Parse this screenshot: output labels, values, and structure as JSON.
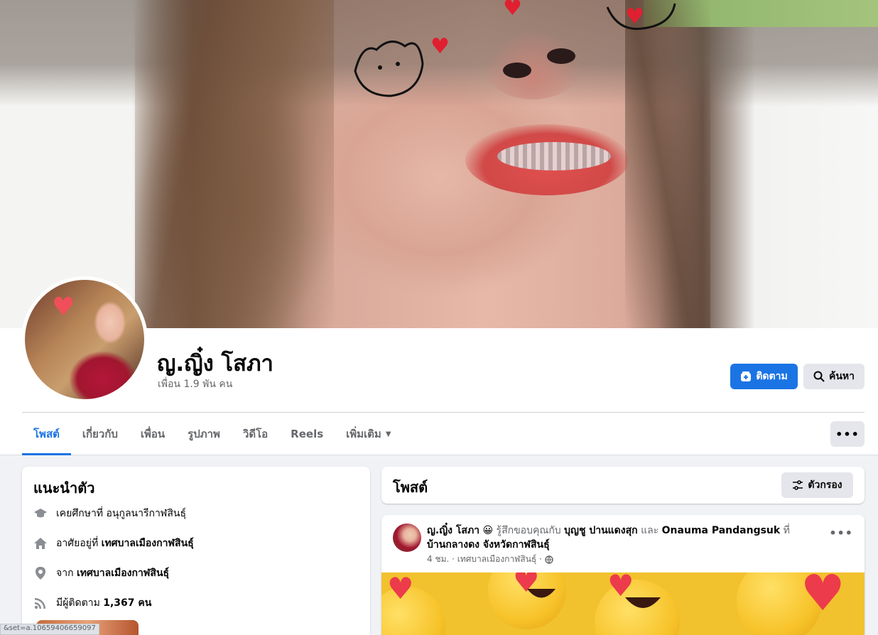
{
  "profile": {
    "name": "ญ.ญิ๋ง โสภา",
    "friends": "เพื่อน 1.9 พัน คน"
  },
  "actions": {
    "follow_label": "ติดตาม",
    "search_label": "ค้นหา",
    "more_label": "•••"
  },
  "tabs": [
    {
      "label": "โพสต์",
      "active": true
    },
    {
      "label": "เกี่ยวกับ"
    },
    {
      "label": "เพื่อน"
    },
    {
      "label": "รูปภาพ"
    },
    {
      "label": "วิดีโอ"
    },
    {
      "label": "Reels"
    },
    {
      "label": "เพิ่มเติม"
    }
  ],
  "intro": {
    "title": "แนะนำตัว",
    "items": [
      {
        "icon": "education-cap-icon",
        "prefix": "เคยศึกษาที่ อนุกูลนารีกาฬสินธุ์",
        "bold": ""
      },
      {
        "icon": "home-icon",
        "prefix": "อาศัยอยู่ที่ ",
        "bold": "เทศบาลเมืองกาฬสินธุ์"
      },
      {
        "icon": "location-pin-icon",
        "prefix": "จาก ",
        "bold": "เทศบาลเมืองกาฬสินธุ์"
      },
      {
        "icon": "rss-followers-icon",
        "prefix": "มีผู้ติดตาม ",
        "bold": "1,367 คน"
      }
    ]
  },
  "posts_section": {
    "title": "โพสต์",
    "filter_label": "ตัวกรอง"
  },
  "post": {
    "author": "ญ.ญิ๋ง โสภา",
    "emoji": "😀",
    "feeling": " รู้สึกขอบคุณกับ ",
    "tag1": "บุญชู ปานแดงสุก",
    "and": " และ ",
    "tag2": "Onauma Pandangsuk",
    "at": " ที่ ",
    "place": "บ้านกลางดง จังหวัดกาฬสินธุ์",
    "meta": "4 ชม. · เทศบาลเมืองกาฬสินธุ์ ·"
  },
  "status_bar": {
    "url": "&set=a.10659406659097"
  },
  "colors": {
    "accent": "#1b74e4",
    "background": "#f0f2f5",
    "muted_text": "#65676b"
  }
}
